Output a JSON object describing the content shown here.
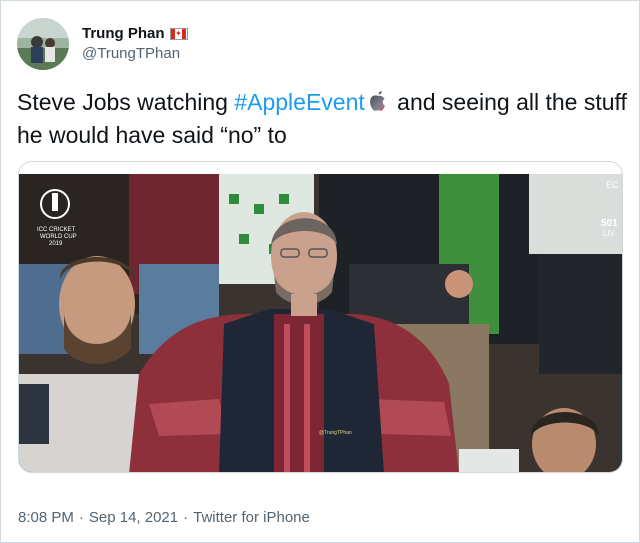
{
  "author": {
    "display_name": "Trung Phan",
    "handle": "@TrungTPhan",
    "flag": "canada-flag-icon"
  },
  "tweet": {
    "text_before": "Steve Jobs watching ",
    "hashtag": "#AppleEvent",
    "hashtag_icon": "apple-logo-icon",
    "text_after": " and seeing all the stuff he would have said “no” to"
  },
  "media": {
    "overlay_tournament_line1": "ICC CRICKET",
    "overlay_tournament_line2": "WORLD CUP",
    "overlay_tournament_line3": "2019",
    "overlay_score_top": "EC",
    "overlay_score_mid": "501",
    "overlay_score_bottom": "LIV",
    "watermark": "@TrungTPhan"
  },
  "meta": {
    "time": "8:08 PM",
    "sep1": "·",
    "date": "Sep 14, 2021",
    "sep2": "·",
    "source": "Twitter for iPhone"
  },
  "colors": {
    "link": "#1d9bf0",
    "secondary_text": "#536471",
    "border": "#cfd9de"
  }
}
